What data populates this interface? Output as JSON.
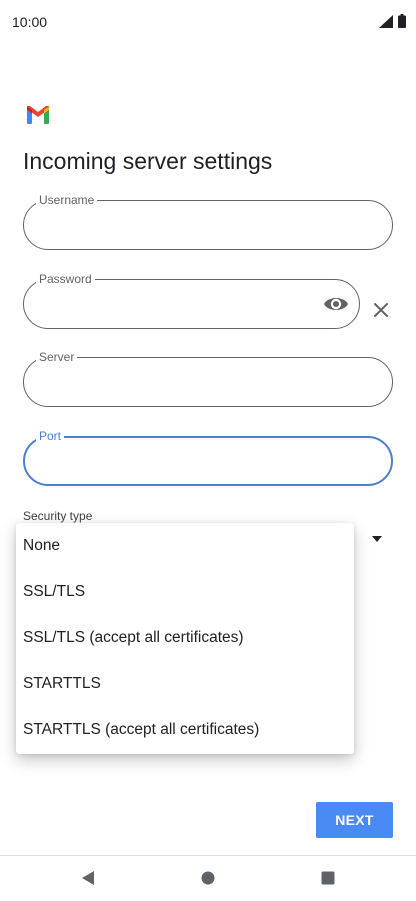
{
  "status_bar": {
    "time": "10:00",
    "icons": [
      "signal-icon",
      "battery-icon"
    ]
  },
  "app": {
    "logo": "gmail-logo",
    "colors": {
      "red": "#EA4335",
      "blue": "#4285F4",
      "green": "#34A853",
      "yellow": "#FBBC04"
    }
  },
  "page": {
    "title": "Incoming server settings"
  },
  "form": {
    "username": {
      "label": "Username",
      "value": ""
    },
    "password": {
      "label": "Password",
      "value": ""
    },
    "server": {
      "label": "Server",
      "value": ""
    },
    "port": {
      "label": "Port",
      "value": "",
      "focused": true
    },
    "security_type": {
      "label": "Security type"
    }
  },
  "dropdown": {
    "options": [
      "None",
      "SSL/TLS",
      "SSL/TLS (accept all certificates)",
      "STARTTLS",
      "STARTTLS (accept all certificates)"
    ]
  },
  "actions": {
    "next_label": "NEXT"
  },
  "nav": {
    "buttons": [
      "back-icon",
      "home-icon",
      "recents-icon"
    ]
  },
  "theme": {
    "accent": "#4A8AF4",
    "focus": "#4A7FD3",
    "outline": "#5F6368"
  }
}
